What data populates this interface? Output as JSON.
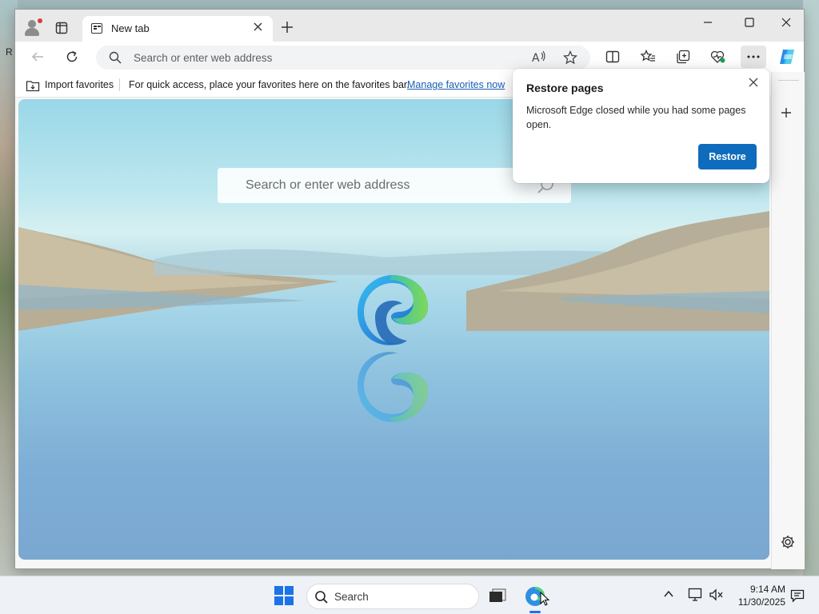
{
  "desktop": {
    "edge_letter": "R"
  },
  "browser": {
    "tab": {
      "title": "New tab"
    },
    "address_bar": {
      "placeholder": "Search or enter web address"
    },
    "favorites_bar": {
      "import_label": "Import favorites",
      "message": "For quick access, place your favorites here on the favorites bar.",
      "link": "Manage favorites now"
    },
    "page": {
      "search_placeholder": "Search or enter web address"
    },
    "popup": {
      "title": "Restore pages",
      "message": "Microsoft Edge closed while you had some pages open.",
      "button": "Restore"
    }
  },
  "taskbar": {
    "search_label": "Search",
    "time": "9:14 AM",
    "date": "11/30/2025"
  },
  "colors": {
    "accent": "#0f6cbd",
    "link": "#1a5fb4",
    "start_blue": "#1a73e8"
  },
  "icons": [
    "profile-icon",
    "tab-actions-icon",
    "close-icon",
    "plus-icon",
    "minimize-icon",
    "maximize-icon",
    "back-icon",
    "refresh-icon",
    "search-icon",
    "read-aloud-icon",
    "favorite-star-icon",
    "split-screen-icon",
    "favorites-icon",
    "collections-icon",
    "browser-essentials-icon",
    "more-icon",
    "copilot-icon",
    "settings-gear-icon",
    "edge-icon",
    "windows-start-icon",
    "task-view-icon",
    "chevron-up-icon",
    "network-icon",
    "volume-icon",
    "notification-icon"
  ]
}
